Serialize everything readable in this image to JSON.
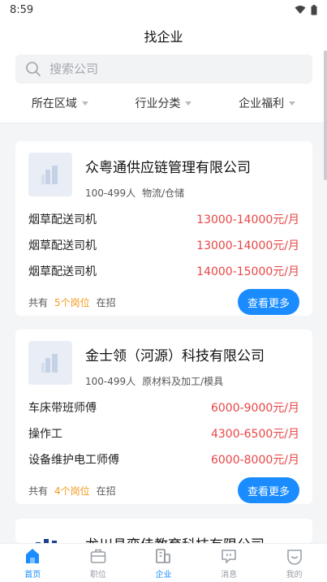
{
  "status": {
    "time": "8:59"
  },
  "header": {
    "title": "找企业"
  },
  "search": {
    "placeholder": "搜索公司"
  },
  "filters": [
    "所在区域",
    "行业分类",
    "企业福利"
  ],
  "companies": [
    {
      "name": "众粤通供应链管理有限公司",
      "size": "100-499人",
      "industry": "物流/仓储",
      "jobs": [
        {
          "title": "烟草配送司机",
          "salary": "13000-14000元/月"
        },
        {
          "title": "烟草配送司机",
          "salary": "13000-14000元/月"
        },
        {
          "title": "烟草配送司机",
          "salary": "14000-15000元/月"
        }
      ],
      "foot_prefix": "共有",
      "foot_count": "5个岗位",
      "foot_suffix": "在招",
      "more_label": "查看更多"
    },
    {
      "name": "金士领（河源）科技有限公司",
      "size": "100-499人",
      "industry": "原材料及加工/模具",
      "jobs": [
        {
          "title": "车床带班师傅",
          "salary": "6000-9000元/月"
        },
        {
          "title": "操作工",
          "salary": "4300-6500元/月"
        },
        {
          "title": "设备维护电工师傅",
          "salary": "6000-8000元/月"
        }
      ],
      "foot_prefix": "共有",
      "foot_count": "4个岗位",
      "foot_suffix": "在招",
      "more_label": "查看更多"
    },
    {
      "name": "龙川县奕佳教育科技有限公司"
    }
  ],
  "tabs": [
    {
      "label": "首页",
      "icon": "home-icon"
    },
    {
      "label": "职位",
      "icon": "briefcase-icon"
    },
    {
      "label": "企业",
      "icon": "building-icon"
    },
    {
      "label": "消息",
      "icon": "message-icon"
    },
    {
      "label": "我的",
      "icon": "profile-icon"
    }
  ],
  "colors": {
    "accent": "#1a8cff",
    "salary": "#e84545",
    "count": "#f39a1f"
  }
}
